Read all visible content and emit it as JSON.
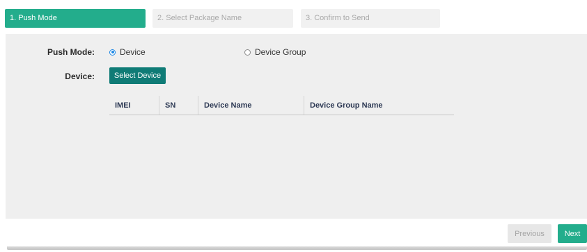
{
  "steps": [
    {
      "label": "1. Push Mode",
      "state": "active"
    },
    {
      "label": "2. Select Package Name",
      "state": "inactive"
    },
    {
      "label": "3. Confirm to Send",
      "state": "inactive"
    }
  ],
  "form": {
    "push_mode_label": "Push Mode:",
    "push_mode_options": [
      {
        "label": "Device",
        "checked": true
      },
      {
        "label": "Device Group",
        "checked": false
      }
    ],
    "device_label": "Device:",
    "select_device_button": "Select Device"
  },
  "table": {
    "columns": [
      "IMEI",
      "SN",
      "Device Name",
      "Device Group Name"
    ],
    "rows": []
  },
  "footer": {
    "previous_label": "Previous",
    "next_label": "Next"
  },
  "colors": {
    "accent": "#23ad8c",
    "select_button": "#0f7b76",
    "radio_checked": "#1e88e5"
  }
}
